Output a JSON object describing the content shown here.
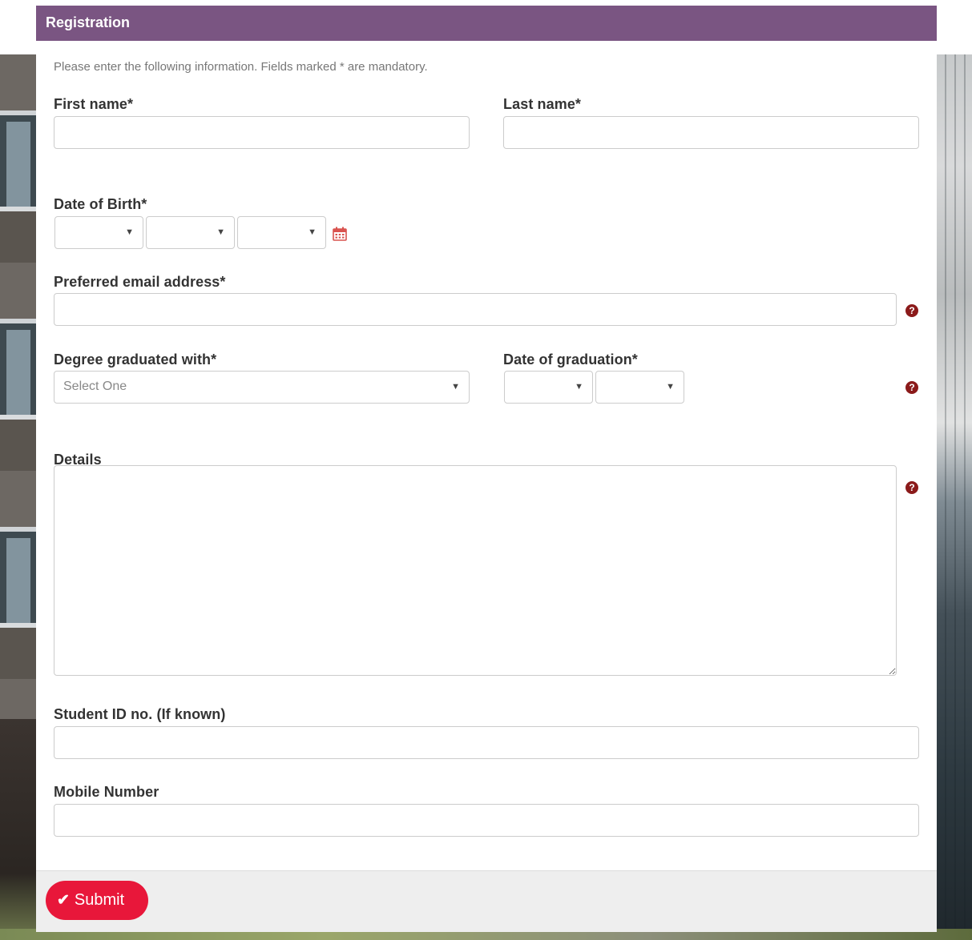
{
  "panel": {
    "title": "Registration",
    "intro": "Please enter the following information. Fields marked * are mandatory.",
    "header_color": "#7a5582"
  },
  "fields": {
    "first_name": {
      "label": "First name*",
      "value": ""
    },
    "last_name": {
      "label": "Last name*",
      "value": ""
    },
    "dob": {
      "label": "Date of Birth*",
      "day": "",
      "month": "",
      "year": "",
      "icon": "calendar-icon"
    },
    "email": {
      "label": "Preferred email address*",
      "value": "",
      "help_icon": "question-circle-icon"
    },
    "degree": {
      "label": "Degree graduated with*",
      "selected": "Select One"
    },
    "graduation_date": {
      "label": "Date of graduation*",
      "month": "",
      "year": ""
    },
    "details": {
      "label": "Details",
      "value": ""
    },
    "student_id": {
      "label": "Student ID no. (If known)",
      "value": ""
    },
    "mobile": {
      "label": "Mobile Number",
      "value": ""
    }
  },
  "help_icon_glyph": "?",
  "submit": {
    "label": "Submit",
    "icon": "check-icon",
    "color": "#e8173a"
  }
}
